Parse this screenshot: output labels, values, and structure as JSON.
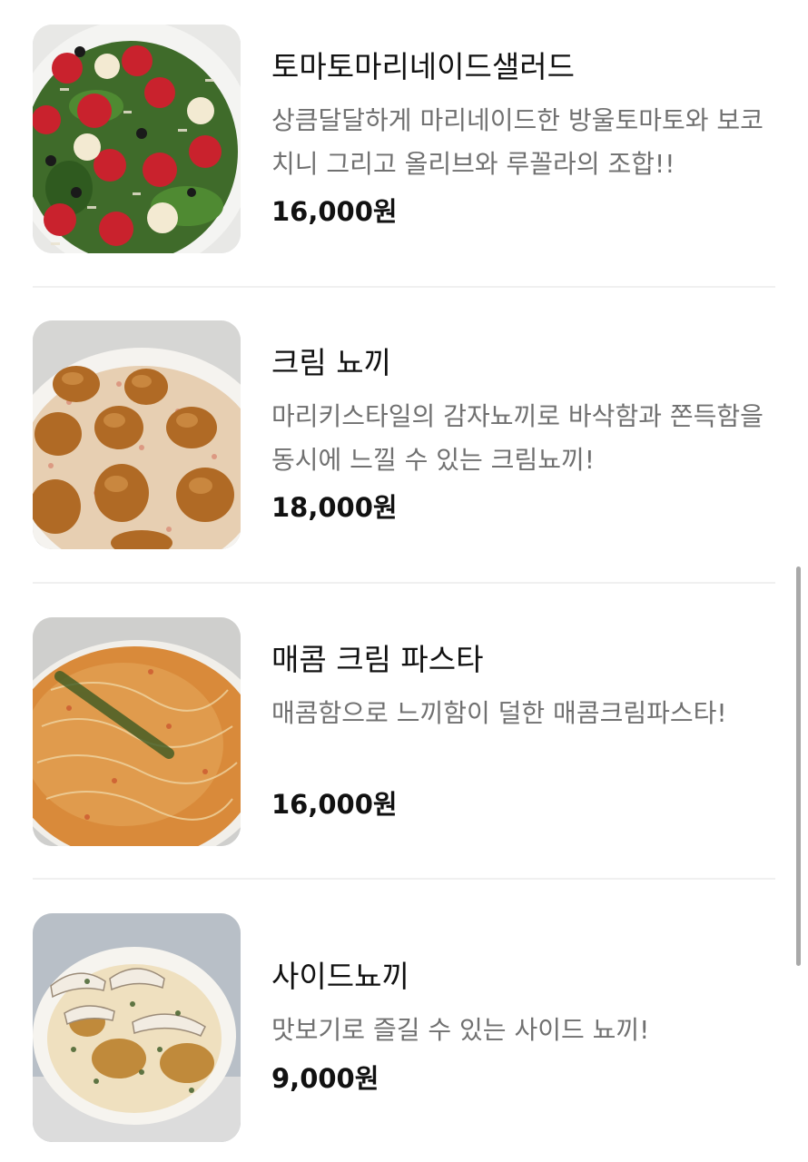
{
  "menu": {
    "items": [
      {
        "name": "토마토마리네이드샐러드",
        "description": "상큼달달하게 마리네이드한 방울토마토와 보코치니 그리고 올리브와 루꼴라의 조합!!",
        "price": "16,000원",
        "image_icon": "salad-photo"
      },
      {
        "name": "크림 뇨끼",
        "description": "마리키스타일의 감자뇨끼로 바삭함과 쫀득함을 동시에 느낄 수 있는 크림뇨끼!",
        "price": "18,000원",
        "image_icon": "cream-gnocchi-photo"
      },
      {
        "name": "매콤 크림 파스타",
        "description": "매콤함으로 느끼함이 덜한 매콤크림파스타!",
        "price": "16,000원",
        "image_icon": "spicy-cream-pasta-photo"
      },
      {
        "name": "사이드뇨끼",
        "description": "맛보기로 즐길 수 있는 사이드 뇨끼!",
        "price": "9,000원",
        "image_icon": "side-gnocchi-photo"
      }
    ]
  }
}
